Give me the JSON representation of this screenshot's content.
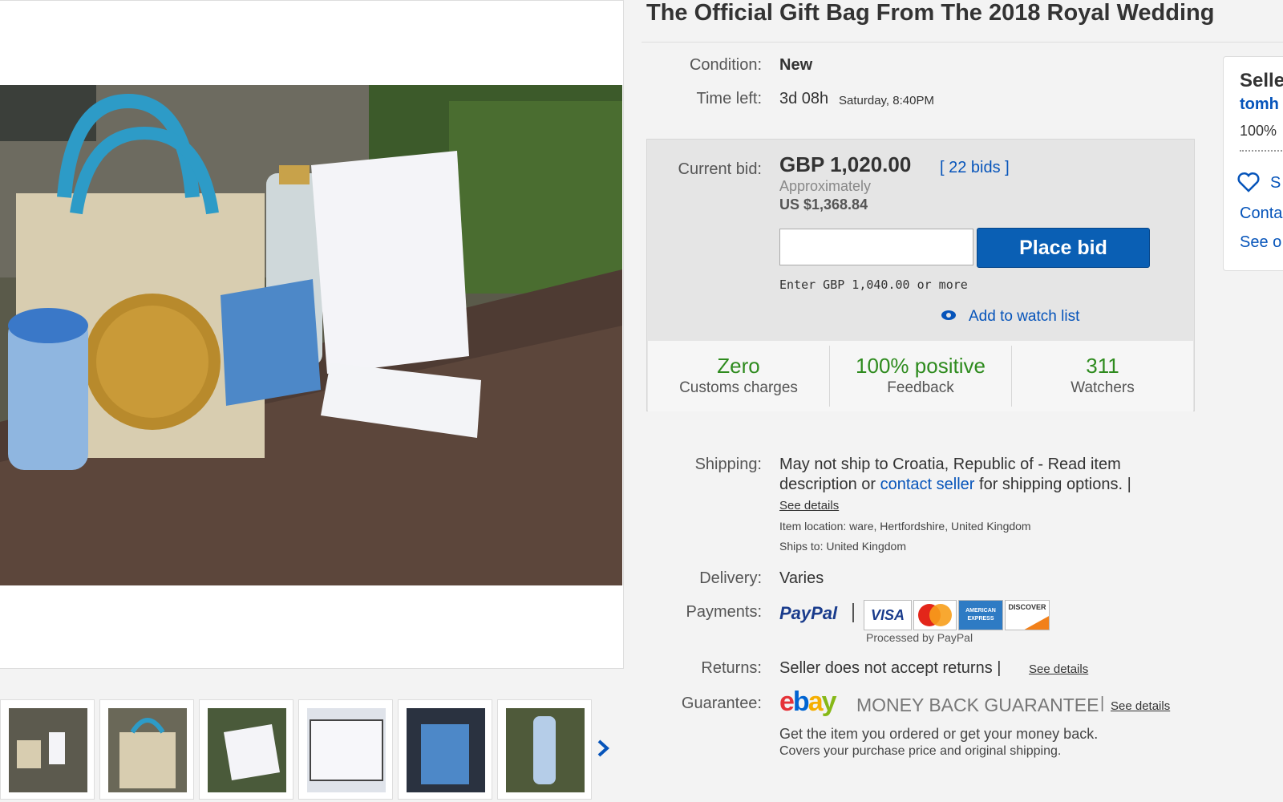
{
  "listing": {
    "title": "The Official Gift Bag From The 2018 Royal Wedding"
  },
  "condition": {
    "label": "Condition:",
    "value": "New"
  },
  "time_left": {
    "label": "Time left:",
    "value": "3d 08h",
    "end": "Saturday, 8:40PM"
  },
  "bid": {
    "label": "Current bid:",
    "amount": "GBP 1,020.00",
    "bids_link": "[ 22 bids ]",
    "approx_label": "Approximately",
    "approx_value": "US $1,368.84",
    "input_placeholder": "",
    "button": "Place bid",
    "hint": "Enter GBP 1,040.00 or more",
    "watch": "Add to watch list"
  },
  "stats": [
    {
      "big": "Zero",
      "small": "Customs charges"
    },
    {
      "big": "100% positive",
      "small": "Feedback"
    },
    {
      "big": "311",
      "small": "Watchers"
    }
  ],
  "shipping": {
    "label": "Shipping:",
    "text1": "May not ship to Croatia, Republic of - Read item",
    "text2a": "description or ",
    "contact": "contact seller",
    "text2b": " for shipping options. |",
    "details": "See details",
    "location": "Item location:  ware, Hertfordshire, United Kingdom",
    "ships_to": "Ships to:  United Kingdom"
  },
  "delivery": {
    "label": "Delivery:",
    "value": "Varies"
  },
  "payments": {
    "label": "Payments:",
    "paypal": "PayPal",
    "visa": "VISA",
    "mastercard": "MasterCard",
    "amex": "AMERICAN EXPRESS",
    "discover": "DISCOVER",
    "processed": "Processed by PayPal"
  },
  "returns": {
    "label": "Returns:",
    "value": "Seller does not accept returns |",
    "details": "See details"
  },
  "guarantee": {
    "label": "Guarantee:",
    "ebay": "ebay",
    "mbg": "MONEY BACK GUARANTEE",
    "sep": "|",
    "details": "See details",
    "line1": "Get the item you ordered or get your money back.",
    "line2": "Covers your purchase price and original shipping."
  },
  "seller": {
    "heading": "Selle",
    "name": "tomh",
    "score": "100%",
    "save": "S",
    "contact": "Conta",
    "see": "See o"
  },
  "thumbnails": [
    "photo-1",
    "photo-2",
    "photo-3",
    "photo-4",
    "photo-5",
    "photo-6"
  ],
  "colors": {
    "accent": "#0a5fb4",
    "link": "#0654ba",
    "green": "#2e8b1e"
  }
}
